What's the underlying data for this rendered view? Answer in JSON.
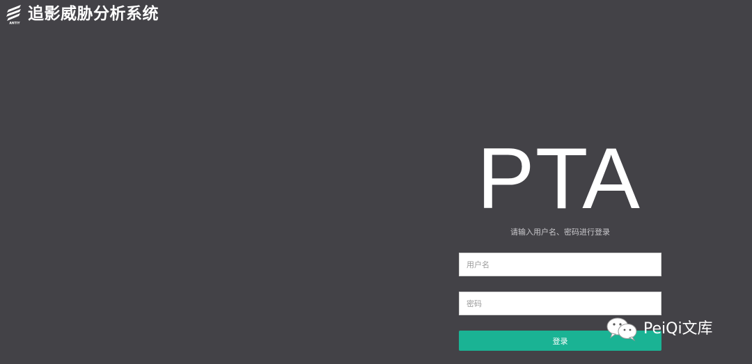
{
  "header": {
    "logo_text": "ANTIY",
    "title": "追影威胁分析系统"
  },
  "login": {
    "heading": "PTA",
    "hint": "请输入用户名、密码进行登录",
    "username_placeholder": "用户名",
    "username_value": "",
    "password_placeholder": "密码",
    "password_value": "",
    "submit_label": "登录"
  },
  "watermark": {
    "text": "PeiQi文库",
    "icon": "wechat-icon"
  },
  "colors": {
    "background": "#434247",
    "accent": "#1ab394",
    "text": "#ffffff"
  }
}
